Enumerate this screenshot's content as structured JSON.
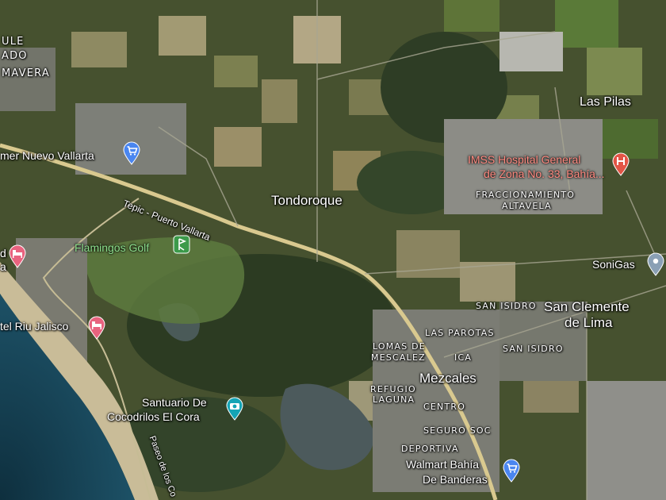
{
  "map": {
    "places": {
      "las_pilas": "Las Pilas",
      "tondoroque": "Tondoroque",
      "san_clemente_line1": "San Clemente",
      "san_clemente_line2": "de Lima",
      "mezcales": "Mezcales"
    },
    "pois": {
      "super_nuevo_vallarta": "mer Nuevo Vallarta",
      "flamingos_golf": "Flamingos Golf",
      "hotel_riu": "tel Riu Jalisco",
      "hotel_left": "d",
      "hotel_left2": "a",
      "santuario_line1": "Santuario De",
      "santuario_line2": "Cocodrilos El Cora",
      "imss_line1": "IMSS Hospital General",
      "imss_line2": "de Zona No. 33, Bahía...",
      "sonigas": "SoniGas",
      "walmart_line1": "Walmart Bahía",
      "walmart_line2": "De Banderas"
    },
    "neighborhoods": {
      "ule": "ULE",
      "ado": "ADO",
      "mavera": "MAVERA",
      "fraccionamiento": "FRACCIONAMIENTO",
      "altavela": "ALTAVELA",
      "san_isidro_1": "SAN ISIDRO",
      "san_isidro_2": "SAN ISIDRO",
      "las_parotas": "LAS PAROTAS",
      "lomas_line1": "LOMAS DE",
      "lomas_line2": "MESCALEZ",
      "refugio_line1": "REFUGIO",
      "refugio_line2": "LAGUNA",
      "centro": "CENTRO",
      "seguro_soc": "SEGURO SOC",
      "deportiva": "DEPORTIVA",
      "ica": "ICA"
    },
    "roads": {
      "tepic_pv": "Tepic - Puerto Vallarta",
      "paseo": "Paseo de los Co"
    },
    "colors": {
      "shopping_pin": "#4a86f0",
      "hotel_pin": "#e8637f",
      "attraction_pin": "#15a4b5",
      "hospital_pin": "#e25546",
      "gas_pin": "#8aa0b5",
      "highway": "#d9c98f"
    }
  }
}
